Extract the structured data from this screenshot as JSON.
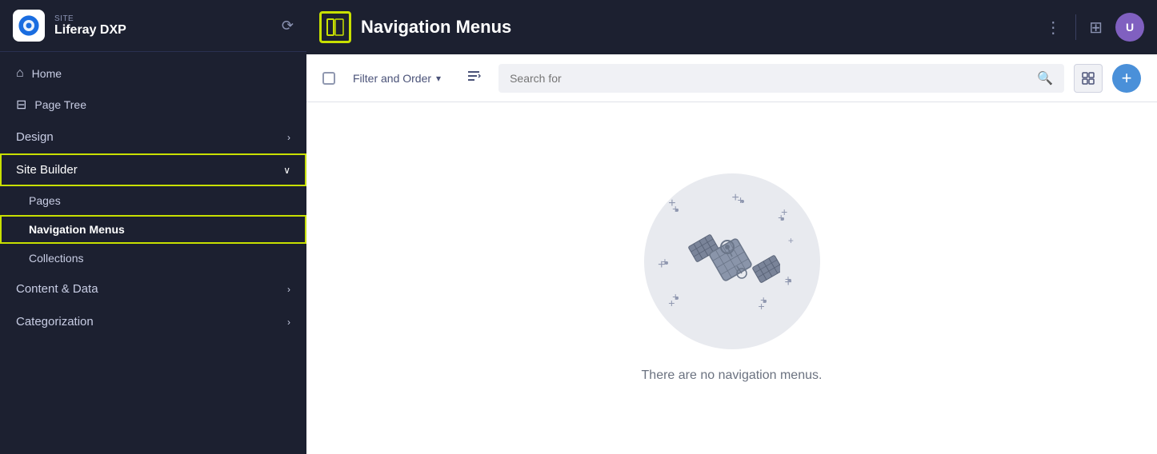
{
  "sidebar": {
    "site_label": "SITE",
    "site_name": "Liferay DXP",
    "nav_items": [
      {
        "id": "home",
        "label": "Home",
        "icon": "⌂",
        "type": "item"
      },
      {
        "id": "page-tree",
        "label": "Page Tree",
        "icon": "⊟",
        "type": "item"
      }
    ],
    "nav_sections": [
      {
        "id": "design",
        "label": "Design",
        "type": "section",
        "expanded": false
      },
      {
        "id": "site-builder",
        "label": "Site Builder",
        "type": "section",
        "expanded": true,
        "highlighted": true,
        "sub_items": [
          {
            "id": "pages",
            "label": "Pages"
          },
          {
            "id": "navigation-menus",
            "label": "Navigation Menus",
            "active": true
          },
          {
            "id": "collections",
            "label": "Collections"
          }
        ]
      },
      {
        "id": "content-data",
        "label": "Content & Data",
        "type": "section",
        "expanded": false
      },
      {
        "id": "categorization",
        "label": "Categorization",
        "type": "section",
        "expanded": false
      }
    ]
  },
  "topbar": {
    "title": "Navigation Menus",
    "icon_symbol": "▣",
    "dots_label": "⋮",
    "grid_label": "⊞",
    "avatar_initials": "U"
  },
  "filterbar": {
    "filter_order_label": "Filter and Order",
    "search_placeholder": "Search for",
    "view_grid_icon": "⊞",
    "add_icon": "+"
  },
  "empty_state": {
    "message": "There are no navigation menus."
  },
  "colors": {
    "highlight": "#c8e000",
    "accent_blue": "#4a90d9",
    "sidebar_bg": "#1c2030",
    "avatar_bg": "#8060c0"
  }
}
